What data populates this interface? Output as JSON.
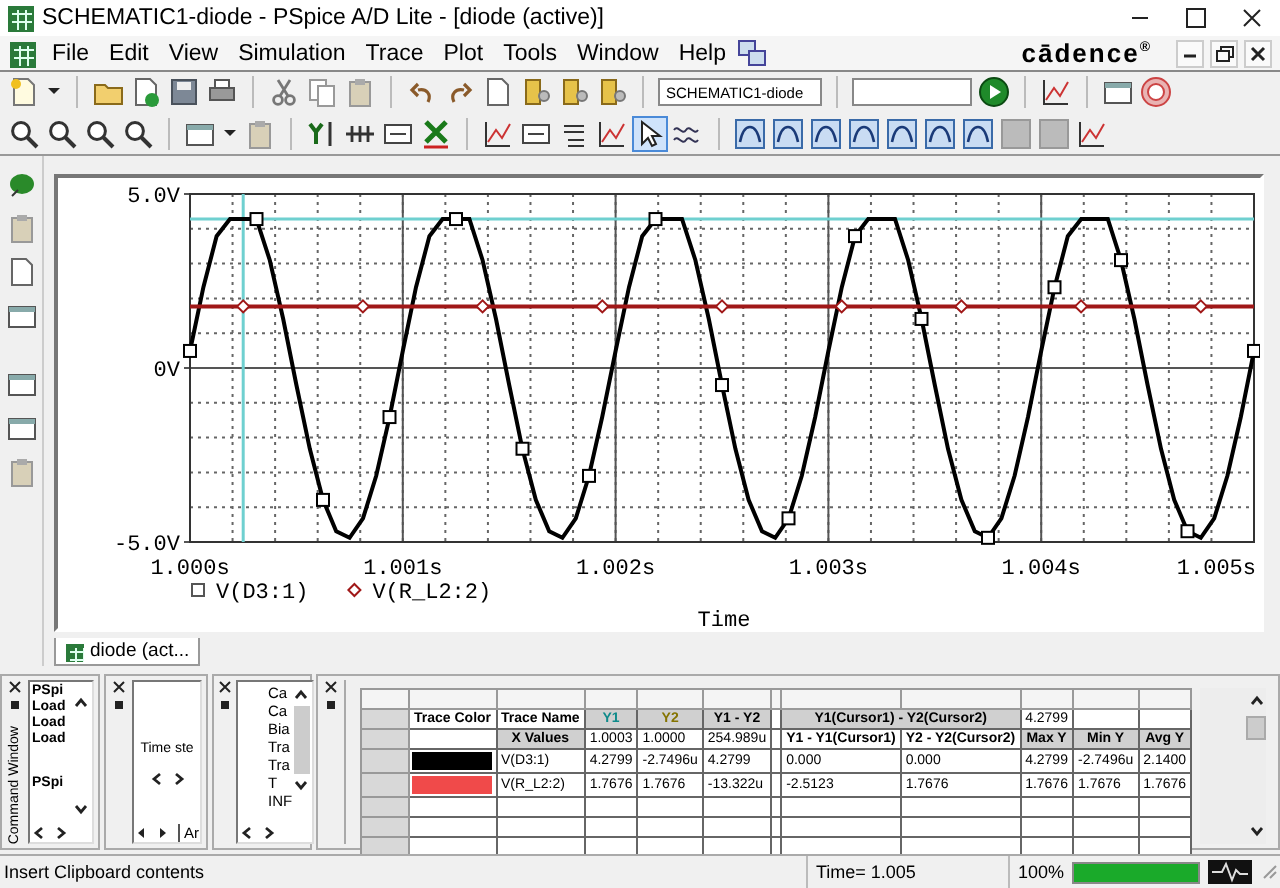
{
  "window": {
    "title": "SCHEMATIC1-diode - PSpice A/D Lite - [diode (active)]"
  },
  "menu": [
    "File",
    "Edit",
    "View",
    "Simulation",
    "Trace",
    "Plot",
    "Tools",
    "Window",
    "Help"
  ],
  "logo": "cādence$^{®}$",
  "toolbar": {
    "design_field": "SCHEMATIC1-diode",
    "select_tool_pressed": true
  },
  "plot": {
    "chart_data": {
      "type": "line",
      "xlabel": "Time",
      "xlim": [
        1,
        1.005
      ],
      "ylim": [
        -5,
        5
      ],
      "xticks": [
        {
          "value": 1,
          "label": "1.000s"
        },
        {
          "value": 1.001,
          "label": "1.001s"
        },
        {
          "value": 1.002,
          "label": "1.002s"
        },
        {
          "value": 1.003,
          "label": "1.003s"
        },
        {
          "value": 1.004,
          "label": "1.004s"
        },
        {
          "value": 1.005,
          "label": "1.005s"
        }
      ],
      "yticks": [
        {
          "value": 5,
          "label": "5.0V"
        },
        {
          "value": 0,
          "label": "0V"
        },
        {
          "value": -5,
          "label": "-5.0V"
        }
      ],
      "x": [
        1,
        1.0000625,
        1.000125,
        1.0001875,
        1.00025,
        1.0003125,
        1.000375,
        1.0004375,
        1.0005,
        1.0005625,
        1.000625,
        1.0006875,
        1.00075,
        1.0008125,
        1.000875,
        1.0009375,
        1.001,
        1.0010625,
        1.001125,
        1.0011875,
        1.00125,
        1.0013125,
        1.001375,
        1.0014375,
        1.0015,
        1.0015625,
        1.001625,
        1.0016875,
        1.00175,
        1.0018125,
        1.001875,
        1.0019375,
        1.002,
        1.0020625,
        1.002125,
        1.0021875,
        1.00225,
        1.0023125,
        1.002375,
        1.0024375,
        1.0025,
        1.0025625,
        1.002625,
        1.0026875,
        1.00275,
        1.0028125,
        1.002875,
        1.0029375,
        1.003,
        1.0030625,
        1.003125,
        1.0031875,
        1.00325,
        1.0033125,
        1.003375,
        1.0034375,
        1.0035,
        1.0035625,
        1.003625,
        1.0036875,
        1.00375,
        1.0038125,
        1.003875,
        1.0039375,
        1.004,
        1.0040625,
        1.004125,
        1.0041875,
        1.00425,
        1.0043125,
        1.004375,
        1.0044375,
        1.0045,
        1.0045625,
        1.004625,
        1.0046875,
        1.00475,
        1.0048125,
        1.004875,
        1.0049375,
        1.005
      ],
      "series": [
        {
          "name": "V(D3:1)",
          "color": "#000000",
          "values": [
            0.49,
            2.32,
            3.79,
            4.28,
            4.28,
            4.28,
            3.1,
            1.41,
            -0.49,
            -2.32,
            -3.79,
            -4.69,
            -4.88,
            -4.32,
            -3.1,
            -1.41,
            0.49,
            2.32,
            3.79,
            4.28,
            4.28,
            4.28,
            3.1,
            1.41,
            -0.49,
            -2.32,
            -3.79,
            -4.69,
            -4.88,
            -4.32,
            -3.1,
            -1.41,
            0.49,
            2.32,
            3.79,
            4.28,
            4.28,
            4.28,
            3.1,
            1.41,
            -0.49,
            -2.32,
            -3.79,
            -4.69,
            -4.88,
            -4.32,
            -3.1,
            -1.41,
            0.49,
            2.32,
            3.79,
            4.28,
            4.28,
            4.28,
            3.1,
            1.41,
            -0.49,
            -2.32,
            -3.79,
            -4.69,
            -4.88,
            -4.32,
            -3.1,
            -1.41,
            0.49,
            2.32,
            3.79,
            4.28,
            4.28,
            4.28,
            3.1,
            1.41,
            -0.49,
            -2.32,
            -3.79,
            -4.69,
            -4.88,
            -4.32,
            -3.1,
            -1.41,
            0.49
          ]
        },
        {
          "name": "V(R_L2:2)",
          "color": "#a01818",
          "values": [
            1.77,
            1.77,
            1.77,
            1.77,
            1.77,
            1.77,
            1.77,
            1.77,
            1.77,
            1.77,
            1.77,
            1.77,
            1.77,
            1.77,
            1.77,
            1.77,
            1.77,
            1.77,
            1.77,
            1.77,
            1.77,
            1.77,
            1.77,
            1.77,
            1.77,
            1.77,
            1.77,
            1.77,
            1.77,
            1.77,
            1.77,
            1.77,
            1.77,
            1.77,
            1.77,
            1.77,
            1.77,
            1.77,
            1.77,
            1.77,
            1.77,
            1.77,
            1.77,
            1.77,
            1.77,
            1.77,
            1.77,
            1.77,
            1.77,
            1.77,
            1.77,
            1.77,
            1.77,
            1.77,
            1.77,
            1.77,
            1.77,
            1.77,
            1.77,
            1.77,
            1.77,
            1.77,
            1.77,
            1.77,
            1.77,
            1.77,
            1.77,
            1.77,
            1.77,
            1.77,
            1.77,
            1.77,
            1.77,
            1.77,
            1.77,
            1.77,
            1.77,
            1.77,
            1.77,
            1.77,
            1.77
          ]
        }
      ],
      "grid": true,
      "ref_lines": [
        {
          "axis": "x",
          "value": 1.00025
        },
        {
          "axis": "y",
          "value": 4.28
        }
      ]
    }
  },
  "document_tabs": [
    {
      "label": "diode (act...",
      "selected": true
    }
  ],
  "command_window": {
    "title": "Command Window",
    "lines": [
      "PSpi",
      "Load",
      "Load",
      "Load",
      "PSpi"
    ]
  },
  "output_panel": {
    "text": "Time ste",
    "tab": "Ar"
  },
  "list_panel": {
    "items": [
      "Ca",
      "Ca",
      "Bia",
      "Tra",
      "Tra",
      "T",
      "INF"
    ]
  },
  "probe_table": {
    "rows": [
      [
        {
          "kind": "heading",
          "text": "Trace Color"
        },
        {
          "kind": "heading",
          "text": "Trace Name"
        },
        {
          "kind": "heading-shaded",
          "text": "Y1",
          "color": "#0e8a8a"
        },
        {
          "kind": "heading-shaded",
          "text": "Y2",
          "color": "#857400"
        },
        {
          "kind": "heading-shaded",
          "text": "Y1 - Y2"
        },
        {
          "kind": "empty"
        },
        {
          "kind": "wide-heading",
          "text": "Y1(Cursor1) - Y2(Cursor2)",
          "colspan": 2
        },
        {
          "kind": "value",
          "text": "4.2799"
        },
        {
          "kind": "empty"
        },
        {
          "kind": "empty"
        }
      ],
      [
        {
          "kind": "empty"
        },
        {
          "kind": "heading-shaded",
          "text": "X Values"
        },
        {
          "kind": "value",
          "text": "1.0003"
        },
        {
          "kind": "value",
          "text": "1.0000"
        },
        {
          "kind": "value",
          "text": "254.989u"
        },
        {
          "kind": "empty"
        },
        {
          "kind": "heading",
          "text": "Y1 - Y1(Cursor1)"
        },
        {
          "kind": "heading",
          "text": "Y2 - Y2(Cursor2)"
        },
        {
          "kind": "heading-shaded",
          "text": "Max Y"
        },
        {
          "kind": "heading-shaded",
          "text": "Min Y"
        },
        {
          "kind": "heading-shaded",
          "text": "Avg Y"
        }
      ],
      [
        {
          "kind": "swatch",
          "color": "#000000"
        },
        {
          "kind": "value",
          "text": "V(D3:1)"
        },
        {
          "kind": "value",
          "text": "4.2799"
        },
        {
          "kind": "value",
          "text": "-2.7496u"
        },
        {
          "kind": "value",
          "text": "4.2799"
        },
        {
          "kind": "empty"
        },
        {
          "kind": "value",
          "text": "0.000"
        },
        {
          "kind": "value",
          "text": "0.000"
        },
        {
          "kind": "value",
          "text": "4.2799"
        },
        {
          "kind": "value",
          "text": "-2.7496u"
        },
        {
          "kind": "value",
          "text": "2.1400"
        }
      ],
      [
        {
          "kind": "swatch",
          "color": "#f04a4a"
        },
        {
          "kind": "value",
          "text": "V(R_L2:2)"
        },
        {
          "kind": "value",
          "text": "1.7676"
        },
        {
          "kind": "value",
          "text": "1.7676"
        },
        {
          "kind": "value",
          "text": "-13.322u"
        },
        {
          "kind": "empty"
        },
        {
          "kind": "value",
          "text": "-2.5123"
        },
        {
          "kind": "value",
          "text": "1.7676"
        },
        {
          "kind": "value",
          "text": "1.7676"
        },
        {
          "kind": "value",
          "text": "1.7676"
        },
        {
          "kind": "value",
          "text": "1.7676"
        }
      ]
    ]
  },
  "status_bar": {
    "message": "Insert Clipboard contents",
    "time": "Time= 1.005",
    "percent": "100%",
    "level": 1
  }
}
